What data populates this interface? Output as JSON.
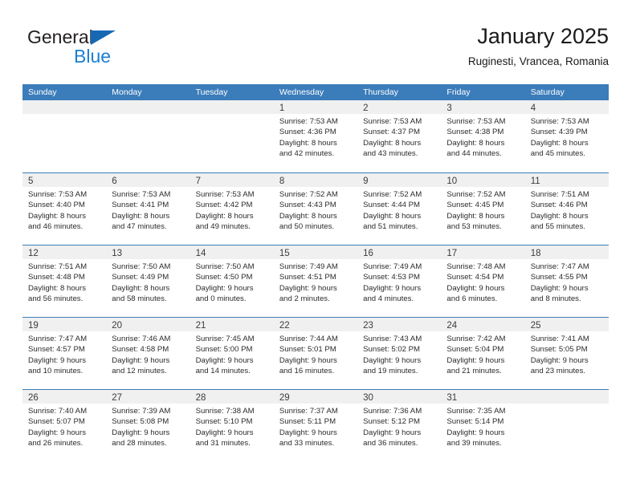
{
  "brand": {
    "name_part1": "General",
    "name_part2": "Blue",
    "triangle_color": "#1668b3",
    "blue_text_color": "#1c7fd4"
  },
  "header": {
    "title": "January 2025",
    "subtitle": "Ruginesti, Vrancea, Romania"
  },
  "theme": {
    "header_blue": "#3b7cba",
    "daynum_band": "#f0f0f0",
    "text": "#2b2b2b"
  },
  "weekdays": [
    "Sunday",
    "Monday",
    "Tuesday",
    "Wednesday",
    "Thursday",
    "Friday",
    "Saturday"
  ],
  "weeks": [
    [
      {
        "empty": true
      },
      {
        "empty": true
      },
      {
        "empty": true
      },
      {
        "day": "1",
        "sunrise": "Sunrise: 7:53 AM",
        "sunset": "Sunset: 4:36 PM",
        "daylight1": "Daylight: 8 hours",
        "daylight2": "and 42 minutes."
      },
      {
        "day": "2",
        "sunrise": "Sunrise: 7:53 AM",
        "sunset": "Sunset: 4:37 PM",
        "daylight1": "Daylight: 8 hours",
        "daylight2": "and 43 minutes."
      },
      {
        "day": "3",
        "sunrise": "Sunrise: 7:53 AM",
        "sunset": "Sunset: 4:38 PM",
        "daylight1": "Daylight: 8 hours",
        "daylight2": "and 44 minutes."
      },
      {
        "day": "4",
        "sunrise": "Sunrise: 7:53 AM",
        "sunset": "Sunset: 4:39 PM",
        "daylight1": "Daylight: 8 hours",
        "daylight2": "and 45 minutes."
      }
    ],
    [
      {
        "day": "5",
        "sunrise": "Sunrise: 7:53 AM",
        "sunset": "Sunset: 4:40 PM",
        "daylight1": "Daylight: 8 hours",
        "daylight2": "and 46 minutes."
      },
      {
        "day": "6",
        "sunrise": "Sunrise: 7:53 AM",
        "sunset": "Sunset: 4:41 PM",
        "daylight1": "Daylight: 8 hours",
        "daylight2": "and 47 minutes."
      },
      {
        "day": "7",
        "sunrise": "Sunrise: 7:53 AM",
        "sunset": "Sunset: 4:42 PM",
        "daylight1": "Daylight: 8 hours",
        "daylight2": "and 49 minutes."
      },
      {
        "day": "8",
        "sunrise": "Sunrise: 7:52 AM",
        "sunset": "Sunset: 4:43 PM",
        "daylight1": "Daylight: 8 hours",
        "daylight2": "and 50 minutes."
      },
      {
        "day": "9",
        "sunrise": "Sunrise: 7:52 AM",
        "sunset": "Sunset: 4:44 PM",
        "daylight1": "Daylight: 8 hours",
        "daylight2": "and 51 minutes."
      },
      {
        "day": "10",
        "sunrise": "Sunrise: 7:52 AM",
        "sunset": "Sunset: 4:45 PM",
        "daylight1": "Daylight: 8 hours",
        "daylight2": "and 53 minutes."
      },
      {
        "day": "11",
        "sunrise": "Sunrise: 7:51 AM",
        "sunset": "Sunset: 4:46 PM",
        "daylight1": "Daylight: 8 hours",
        "daylight2": "and 55 minutes."
      }
    ],
    [
      {
        "day": "12",
        "sunrise": "Sunrise: 7:51 AM",
        "sunset": "Sunset: 4:48 PM",
        "daylight1": "Daylight: 8 hours",
        "daylight2": "and 56 minutes."
      },
      {
        "day": "13",
        "sunrise": "Sunrise: 7:50 AM",
        "sunset": "Sunset: 4:49 PM",
        "daylight1": "Daylight: 8 hours",
        "daylight2": "and 58 minutes."
      },
      {
        "day": "14",
        "sunrise": "Sunrise: 7:50 AM",
        "sunset": "Sunset: 4:50 PM",
        "daylight1": "Daylight: 9 hours",
        "daylight2": "and 0 minutes."
      },
      {
        "day": "15",
        "sunrise": "Sunrise: 7:49 AM",
        "sunset": "Sunset: 4:51 PM",
        "daylight1": "Daylight: 9 hours",
        "daylight2": "and 2 minutes."
      },
      {
        "day": "16",
        "sunrise": "Sunrise: 7:49 AM",
        "sunset": "Sunset: 4:53 PM",
        "daylight1": "Daylight: 9 hours",
        "daylight2": "and 4 minutes."
      },
      {
        "day": "17",
        "sunrise": "Sunrise: 7:48 AM",
        "sunset": "Sunset: 4:54 PM",
        "daylight1": "Daylight: 9 hours",
        "daylight2": "and 6 minutes."
      },
      {
        "day": "18",
        "sunrise": "Sunrise: 7:47 AM",
        "sunset": "Sunset: 4:55 PM",
        "daylight1": "Daylight: 9 hours",
        "daylight2": "and 8 minutes."
      }
    ],
    [
      {
        "day": "19",
        "sunrise": "Sunrise: 7:47 AM",
        "sunset": "Sunset: 4:57 PM",
        "daylight1": "Daylight: 9 hours",
        "daylight2": "and 10 minutes."
      },
      {
        "day": "20",
        "sunrise": "Sunrise: 7:46 AM",
        "sunset": "Sunset: 4:58 PM",
        "daylight1": "Daylight: 9 hours",
        "daylight2": "and 12 minutes."
      },
      {
        "day": "21",
        "sunrise": "Sunrise: 7:45 AM",
        "sunset": "Sunset: 5:00 PM",
        "daylight1": "Daylight: 9 hours",
        "daylight2": "and 14 minutes."
      },
      {
        "day": "22",
        "sunrise": "Sunrise: 7:44 AM",
        "sunset": "Sunset: 5:01 PM",
        "daylight1": "Daylight: 9 hours",
        "daylight2": "and 16 minutes."
      },
      {
        "day": "23",
        "sunrise": "Sunrise: 7:43 AM",
        "sunset": "Sunset: 5:02 PM",
        "daylight1": "Daylight: 9 hours",
        "daylight2": "and 19 minutes."
      },
      {
        "day": "24",
        "sunrise": "Sunrise: 7:42 AM",
        "sunset": "Sunset: 5:04 PM",
        "daylight1": "Daylight: 9 hours",
        "daylight2": "and 21 minutes."
      },
      {
        "day": "25",
        "sunrise": "Sunrise: 7:41 AM",
        "sunset": "Sunset: 5:05 PM",
        "daylight1": "Daylight: 9 hours",
        "daylight2": "and 23 minutes."
      }
    ],
    [
      {
        "day": "26",
        "sunrise": "Sunrise: 7:40 AM",
        "sunset": "Sunset: 5:07 PM",
        "daylight1": "Daylight: 9 hours",
        "daylight2": "and 26 minutes."
      },
      {
        "day": "27",
        "sunrise": "Sunrise: 7:39 AM",
        "sunset": "Sunset: 5:08 PM",
        "daylight1": "Daylight: 9 hours",
        "daylight2": "and 28 minutes."
      },
      {
        "day": "28",
        "sunrise": "Sunrise: 7:38 AM",
        "sunset": "Sunset: 5:10 PM",
        "daylight1": "Daylight: 9 hours",
        "daylight2": "and 31 minutes."
      },
      {
        "day": "29",
        "sunrise": "Sunrise: 7:37 AM",
        "sunset": "Sunset: 5:11 PM",
        "daylight1": "Daylight: 9 hours",
        "daylight2": "and 33 minutes."
      },
      {
        "day": "30",
        "sunrise": "Sunrise: 7:36 AM",
        "sunset": "Sunset: 5:12 PM",
        "daylight1": "Daylight: 9 hours",
        "daylight2": "and 36 minutes."
      },
      {
        "day": "31",
        "sunrise": "Sunrise: 7:35 AM",
        "sunset": "Sunset: 5:14 PM",
        "daylight1": "Daylight: 9 hours",
        "daylight2": "and 39 minutes."
      },
      {
        "empty": true
      }
    ]
  ]
}
